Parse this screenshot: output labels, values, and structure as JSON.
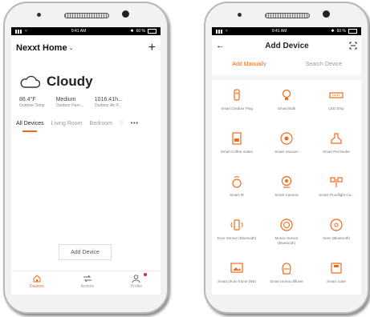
{
  "accent_color": "#f26a1b",
  "status": {
    "time": "9:41 AM",
    "battery": "60 %"
  },
  "home": {
    "title": "Nexxt Home",
    "weather": "Cloudy",
    "stats": [
      {
        "value": "86.4°F",
        "label": "Outdoor Temp"
      },
      {
        "value": "Medium",
        "label": "Outdoor Hum..."
      },
      {
        "value": "1016.41h...",
        "label": "Outdoor Air P..."
      }
    ],
    "tabs": [
      "All Devices",
      "Living Room",
      "Bedroom",
      "S"
    ],
    "add_device_label": "Add Device",
    "nav": [
      "Devices",
      "Actions",
      "Profile"
    ]
  },
  "add_device": {
    "title": "Add Device",
    "tabs": [
      "Add Manually",
      "Search Device"
    ],
    "devices": [
      {
        "label": "Smart Outdoor Plug",
        "icon": "outdoor-plug-icon"
      },
      {
        "label": "Smart Bulb",
        "icon": "bulb-icon"
      },
      {
        "label": "LED Strip",
        "icon": "led-strip-icon"
      },
      {
        "label": "Smart Coffee maker",
        "icon": "coffee-maker-icon"
      },
      {
        "label": "Smart Vacuum",
        "icon": "vacuum-icon"
      },
      {
        "label": "Smart Pet feeder",
        "icon": "pet-feeder-icon"
      },
      {
        "label": "Smart IR",
        "icon": "ir-icon"
      },
      {
        "label": "Smart Camera",
        "icon": "camera-icon"
      },
      {
        "label": "Smart Floodlight Ca...",
        "icon": "floodlight-icon"
      },
      {
        "label": "Door Sensor (Bluetooth)",
        "icon": "door-sensor-icon"
      },
      {
        "label": "Motion Sensor (Bluetooth)",
        "icon": "motion-sensor-icon"
      },
      {
        "label": "Siren (Bluetooth)",
        "icon": "siren-icon"
      },
      {
        "label": "Smart photo frame (NB)",
        "icon": "photo-frame-icon"
      },
      {
        "label": "Smart aroma diffuser",
        "icon": "aroma-diffuser-icon"
      },
      {
        "label": "Smart scale",
        "icon": "scale-icon"
      }
    ]
  }
}
